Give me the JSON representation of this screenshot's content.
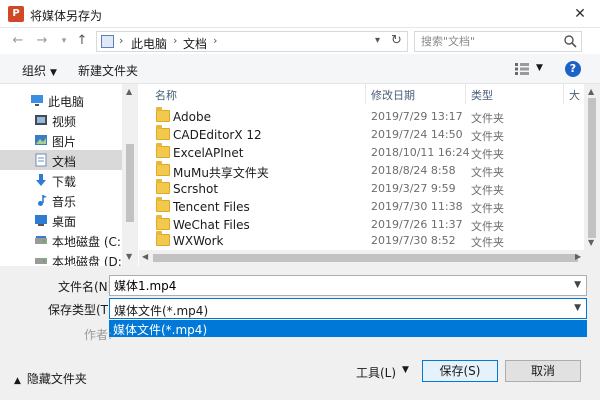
{
  "window": {
    "title": "将媒体另存为",
    "app_badge": "P",
    "close_glyph": "✕"
  },
  "address": {
    "breadcrumbs": [
      "此电脑",
      "文档"
    ],
    "separator": "›",
    "search_placeholder": "搜索\"文档\""
  },
  "toolbar": {
    "organize": "组织",
    "new_folder": "新建文件夹",
    "help": "?"
  },
  "sidebar": {
    "items": [
      {
        "label": "此电脑",
        "icon": "pc-icon"
      },
      {
        "label": "视频",
        "icon": "video-icon"
      },
      {
        "label": "图片",
        "icon": "picture-icon"
      },
      {
        "label": "文档",
        "icon": "document-icon",
        "selected": true
      },
      {
        "label": "下载",
        "icon": "download-icon"
      },
      {
        "label": "音乐",
        "icon": "music-icon"
      },
      {
        "label": "桌面",
        "icon": "desktop-icon"
      },
      {
        "label": "本地磁盘 (C:)",
        "icon": "drive-icon"
      },
      {
        "label": "本地磁盘 (D:)",
        "icon": "drive-icon"
      }
    ]
  },
  "filelist": {
    "headers": {
      "name": "名称",
      "date": "修改日期",
      "type": "类型",
      "size": "大"
    },
    "rows": [
      {
        "name": "Adobe",
        "date": "2019/7/29 13:17",
        "type": "文件夹"
      },
      {
        "name": "CADEditorX 12",
        "date": "2019/7/24 14:50",
        "type": "文件夹"
      },
      {
        "name": "ExcelAPInet",
        "date": "2018/10/11 16:24",
        "type": "文件夹"
      },
      {
        "name": "MuMu共享文件夹",
        "date": "2018/8/24 8:58",
        "type": "文件夹"
      },
      {
        "name": "Scrshot",
        "date": "2019/3/27 9:59",
        "type": "文件夹"
      },
      {
        "name": "Tencent Files",
        "date": "2019/7/30 11:38",
        "type": "文件夹"
      },
      {
        "name": "WeChat Files",
        "date": "2019/7/26 11:37",
        "type": "文件夹"
      },
      {
        "name": "WXWork",
        "date": "2019/7/30 8:52",
        "type": "文件夹"
      }
    ]
  },
  "form": {
    "filename_label": "文件名(N):",
    "filename_value": "媒体1.mp4",
    "savetype_label": "保存类型(T):",
    "savetype_value": "媒体文件(*.mp4)",
    "dropdown_options": [
      "媒体文件(*.mp4)"
    ],
    "author_label": "作者:"
  },
  "footer": {
    "hide_folders": "隐藏文件夹",
    "tools": "工具(L)",
    "save": "保存(S)",
    "cancel": "取消"
  },
  "colors": {
    "accent": "#0078d7",
    "folder": "#f2c94c",
    "app": "#d24726"
  }
}
